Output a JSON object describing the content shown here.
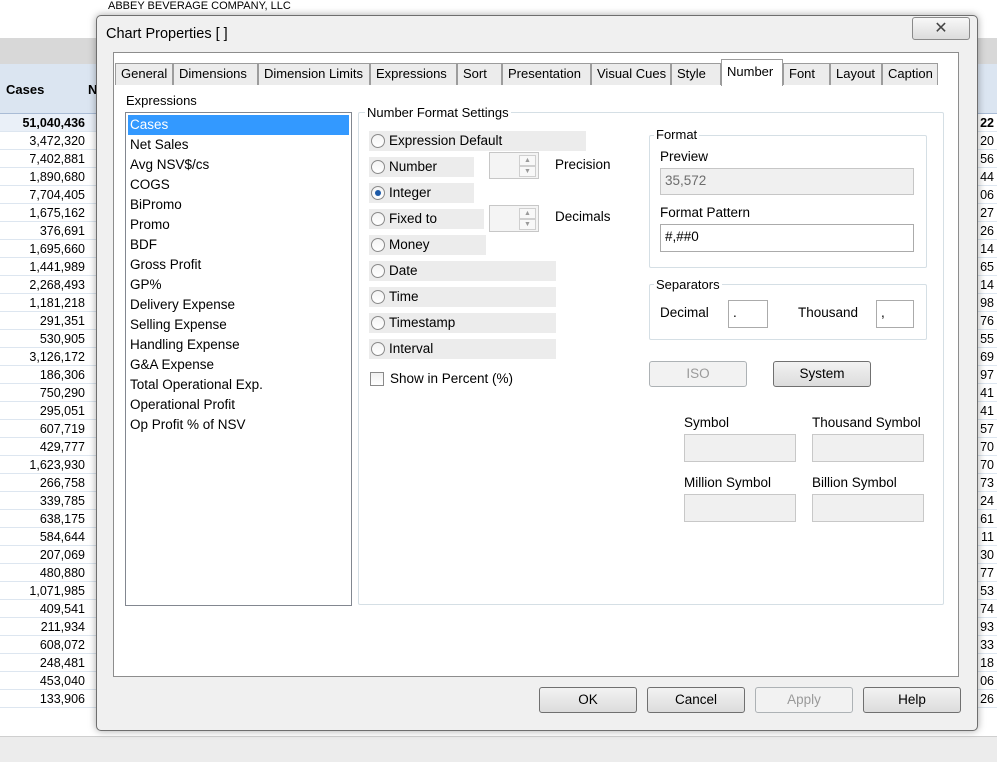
{
  "background": {
    "company": "ABBEY BEVERAGE COMPANY, LLC",
    "table_header": "Cases",
    "table_header_clip": "N",
    "cells": [
      "51,040,436",
      "3,472,320",
      "7,402,881",
      "1,890,680",
      "7,704,405",
      "1,675,162",
      "376,691",
      "1,695,660",
      "1,441,989",
      "2,268,493",
      "1,181,218",
      "291,351",
      "530,905",
      "3,126,172",
      "186,306",
      "750,290",
      "295,051",
      "607,719",
      "429,777",
      "1,623,930",
      "266,758",
      "339,785",
      "638,175",
      "584,644",
      "207,069",
      "480,880",
      "1,071,985",
      "409,541",
      "211,934",
      "608,072",
      "248,481",
      "453,040",
      "133,906"
    ],
    "right_cells": [
      "22",
      "20",
      "56",
      "44",
      "06",
      "27",
      "26",
      "14",
      "65",
      "14",
      "98",
      "76",
      "55",
      "69",
      "97",
      "41",
      "41",
      "57",
      "70",
      "70",
      "73",
      "24",
      "61",
      "11",
      "30",
      "77",
      "53",
      "74",
      "93",
      "33",
      "18",
      "06",
      "26"
    ]
  },
  "dialog": {
    "title": "Chart Properties [ ]",
    "close_glyph": "✕",
    "tabs": [
      "General",
      "Dimensions",
      "Dimension Limits",
      "Expressions",
      "Sort",
      "Presentation",
      "Visual Cues",
      "Style",
      "Number",
      "Font",
      "Layout",
      "Caption"
    ],
    "active_tab": "Number",
    "expressions_label": "Expressions",
    "expressions": [
      "Cases",
      "Net Sales",
      "Avg NSV$/cs",
      "COGS",
      "BiPromo",
      "Promo",
      "BDF",
      "Gross Profit",
      "GP%",
      "Delivery Expense",
      "Selling Expense",
      "Handling Expense",
      "G&A Expense",
      "Total Operational Exp.",
      "Operational Profit",
      "Op Profit % of NSV"
    ],
    "selected_expression": "Cases",
    "number_format": {
      "label": "Number Format Settings",
      "options": [
        "Expression Default",
        "Number",
        "Integer",
        "Fixed to",
        "Money",
        "Date",
        "Time",
        "Timestamp",
        "Interval"
      ],
      "selected": "Integer",
      "precision_label": "Precision",
      "decimals_label": "Decimals",
      "show_percent_label": "Show in Percent (%)"
    },
    "format": {
      "label": "Format",
      "preview_label": "Preview",
      "preview_value": "35,572",
      "pattern_label": "Format Pattern",
      "pattern_value": "#,##0"
    },
    "separators": {
      "label": "Separators",
      "decimal_label": "Decimal",
      "decimal_value": ".",
      "thousand_label": "Thousand",
      "thousand_value": ","
    },
    "iso_label": "ISO",
    "system_label": "System",
    "symbols": {
      "symbol_label": "Symbol",
      "thousand_symbol_label": "Thousand Symbol",
      "million_symbol_label": "Million Symbol",
      "billion_symbol_label": "Billion Symbol"
    },
    "buttons": {
      "ok": "OK",
      "cancel": "Cancel",
      "apply": "Apply",
      "help": "Help"
    }
  }
}
